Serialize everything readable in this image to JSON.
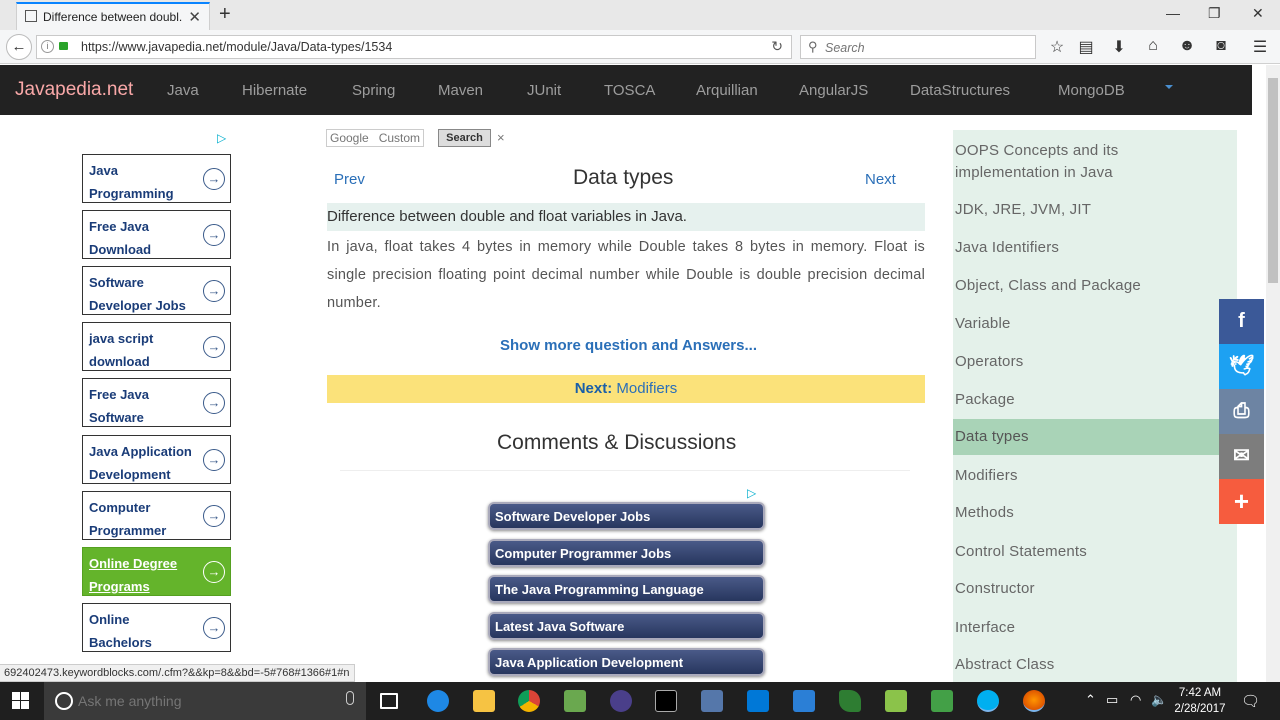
{
  "browser": {
    "tab_title": "Difference between doubl...",
    "url": "https://www.javapedia.net/module/Java/Data-types/1534",
    "search_placeholder": "Search"
  },
  "site": {
    "logo": "Javapedia.net",
    "nav": [
      "Java",
      "Hibernate",
      "Spring",
      "Maven",
      "JUnit",
      "TOSCA",
      "Arquillian",
      "AngularJS",
      "DataStructures",
      "MongoDB"
    ]
  },
  "left_ads": [
    {
      "line1": "Java",
      "line2": "Programming"
    },
    {
      "line1": "Free Java",
      "line2": "Download"
    },
    {
      "line1": "Software",
      "line2": "Developer Jobs"
    },
    {
      "line1": "java script",
      "line2": "download"
    },
    {
      "line1": "Free Java",
      "line2": "Software"
    },
    {
      "line1": "Java Application",
      "line2": "Development"
    },
    {
      "line1": "Computer",
      "line2": "Programmer"
    },
    {
      "line1": "Online Degree",
      "line2": "Programs"
    },
    {
      "line1": "Online",
      "line2": "Bachelors"
    }
  ],
  "google_search": {
    "placeholder": "Google   Custom",
    "button": "Search",
    "clear": "×"
  },
  "main": {
    "prev": "Prev",
    "title": "Data types",
    "next": "Next",
    "question": "Difference between double and float variables in Java.",
    "answer": "In java, float takes 4 bytes in memory while Double takes 8 bytes in memory. Float is single precision floating point decimal number while Double is double precision decimal number.",
    "show_more": "Show more question and Answers...",
    "next_bar_label": "Next:",
    "next_bar_link": "Modifiers",
    "comments_heading": "Comments & Discussions"
  },
  "mid_ads": [
    "Software Developer Jobs",
    "Computer Programmer Jobs",
    "The Java Programming Language",
    "Latest Java Software",
    "Java Application Development"
  ],
  "sidebar": {
    "items": [
      "OOPS Concepts and its implementation in Java",
      "JDK, JRE, JVM, JIT",
      "Java Identifiers",
      "Object, Class and Package",
      "Variable",
      "Operators",
      "Package",
      "Data types",
      "Modifiers",
      "Methods",
      "Control Statements",
      "Constructor",
      "Interface",
      "Abstract Class"
    ],
    "active": "Data types"
  },
  "share": {
    "colors": {
      "facebook": "#3b5998",
      "twitter": "#1da1f2",
      "print": "#6d84a3",
      "email": "#7d7d7d",
      "more": "#f65c3e"
    }
  },
  "status_bar": "692402473.keywordblocks.com/.cfm?&&kp=8&&bd=-5#768#1366#1#n",
  "taskbar": {
    "cortana_placeholder": "Ask me anything",
    "time": "7:42 AM",
    "date": "2/28/2017"
  },
  "colors": {
    "header_bg": "#222222",
    "logo": "#f9a8a8",
    "link": "#2a6fb8",
    "sidebar_bg": "#e4f1ea",
    "sidebar_active": "#a9d3b7",
    "next_bar": "#fbe27a",
    "online_degree_ad": "#64b42b"
  }
}
